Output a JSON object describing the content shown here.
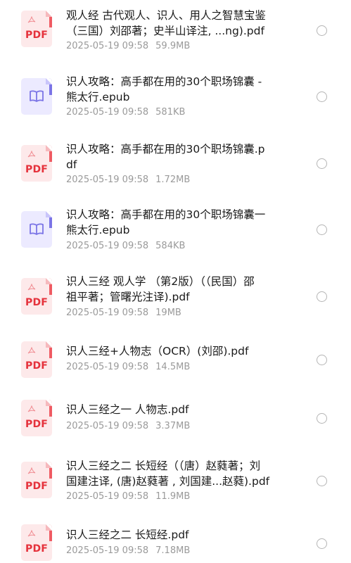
{
  "files": [
    {
      "type": "pdf",
      "icon": "pdf-file-icon",
      "name_lines": [
        "观人经 古代观人、识人、用人之智慧宝鉴",
        "（三国）刘邵著；史半山译注, ...ng).pdf"
      ],
      "date": "2025-05-19 09:58",
      "size": "59.9MB"
    },
    {
      "type": "epub",
      "icon": "epub-book-icon",
      "name_lines": [
        "识人攻略：高手都在用的30个职场锦囊 -",
        "熊太行.epub"
      ],
      "date": "2025-05-19 09:58",
      "size": "581KB"
    },
    {
      "type": "pdf",
      "icon": "pdf-file-icon",
      "name_lines": [
        "识人攻略：高手都在用的30个职场锦囊.p",
        "df"
      ],
      "date": "2025-05-19 09:58",
      "size": "1.72MB"
    },
    {
      "type": "epub",
      "icon": "epub-book-icon",
      "name_lines": [
        "识人攻略：高手都在用的30个职场锦囊一",
        "熊太行.epub"
      ],
      "date": "2025-05-19 09:58",
      "size": "584KB"
    },
    {
      "type": "pdf",
      "icon": "pdf-file-icon",
      "name_lines": [
        "识人三经 观人学 （第2版）（（民国）邵",
        "祖平著；管曙光注译).pdf"
      ],
      "date": "2025-05-19 09:58",
      "size": "19MB"
    },
    {
      "type": "pdf",
      "icon": "pdf-file-icon",
      "name_lines": [
        "识人三经+人物志（OCR）(刘邵).pdf"
      ],
      "date": "2025-05-19 09:58",
      "size": "14.5MB"
    },
    {
      "type": "pdf",
      "icon": "pdf-file-icon",
      "name_lines": [
        "识人三经之一 人物志.pdf"
      ],
      "date": "2025-05-19 09:58",
      "size": "3.37MB"
    },
    {
      "type": "pdf",
      "icon": "pdf-file-icon",
      "name_lines": [
        "识人三经之二 长短经（（唐）赵蕤著；刘",
        "国建注译, (唐)赵蕤著 , 刘国建...赵蕤).pdf"
      ],
      "date": "2025-05-19 09:58",
      "size": "11.9MB"
    },
    {
      "type": "pdf",
      "icon": "pdf-file-icon",
      "name_lines": [
        "识人三经之二 长短经.pdf"
      ],
      "date": "2025-05-19 09:58",
      "size": "7.18MB"
    }
  ],
  "labels": {
    "pdf_badge": "PDF"
  },
  "colors": {
    "pdf_accent": "#e5323c",
    "epub_accent": "#7b74e6",
    "meta_text": "#9a9a9a"
  }
}
